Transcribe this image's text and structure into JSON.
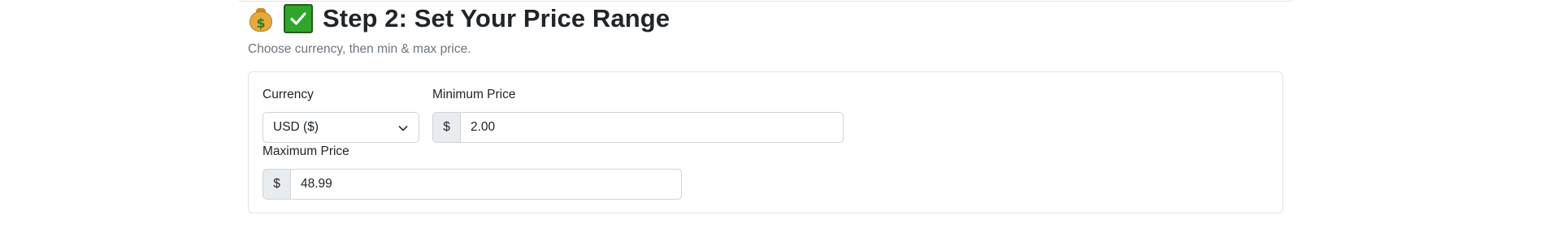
{
  "step": {
    "title": "Step 2: Set Your Price Range",
    "subtitle": "Choose currency, then min & max price.",
    "icons": [
      "money-bag-icon",
      "check-mark-button-icon"
    ]
  },
  "form": {
    "currency": {
      "label": "Currency",
      "selected": "USD ($)"
    },
    "min_price": {
      "label": "Minimum Price",
      "prefix": "$",
      "value": "2.00"
    },
    "max_price": {
      "label": "Maximum Price",
      "prefix": "$",
      "value": "48.99"
    }
  },
  "colors": {
    "accent_check": "#2fa52a",
    "muted_text": "#6c757d",
    "border": "#ced4da",
    "addon_bg": "#e9ecef"
  }
}
